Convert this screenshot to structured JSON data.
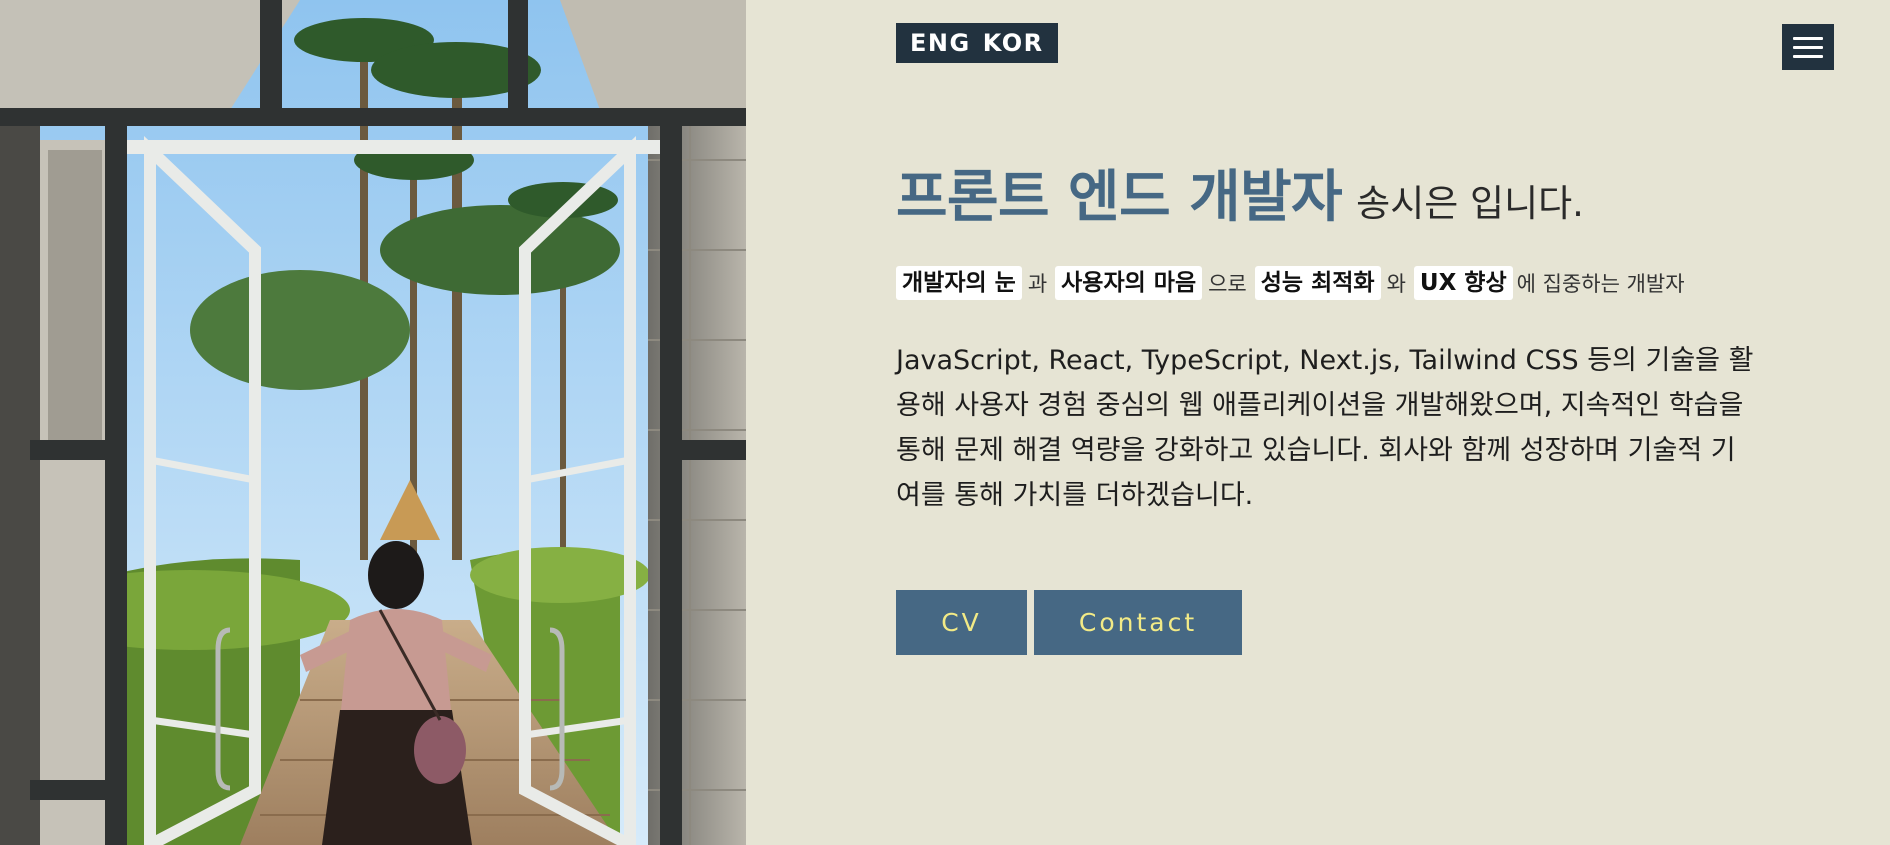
{
  "header": {
    "language_options": [
      "ENG",
      "KOR"
    ],
    "menu_icon": "hamburger-menu-icon"
  },
  "hero": {
    "photo": "photo of a person opening glass double doors onto a garden path lined with palm trees",
    "title_role": "프론트 엔드 개발자",
    "title_rest": "송시은 입니다.",
    "tagline": {
      "highlights": [
        "개발자의 눈",
        "사용자의 마음",
        "성능 최적화",
        "UX 향상"
      ],
      "joiners": [
        "과",
        "으로",
        "와"
      ],
      "ending": "에 집중하는 개발자"
    },
    "intro": "JavaScript, React, TypeScript, Next.js, Tailwind CSS 등의 기술을 활용해 사용자 경험 중심의 웹 애플리케이션을 개발해왔으며, 지속적인 학습을 통해 문제 해결 역량을 강화하고 있습니다. 회사와 함께 성장하며 기술적 기여를 통해 가치를 더하겠습니다."
  },
  "buttons": {
    "cv_label": "CV",
    "contact_label": "Contact"
  },
  "colors": {
    "background": "#e6e4d4",
    "dark": "#22323f",
    "accent": "#466884",
    "button_text": "#f2ea86"
  }
}
